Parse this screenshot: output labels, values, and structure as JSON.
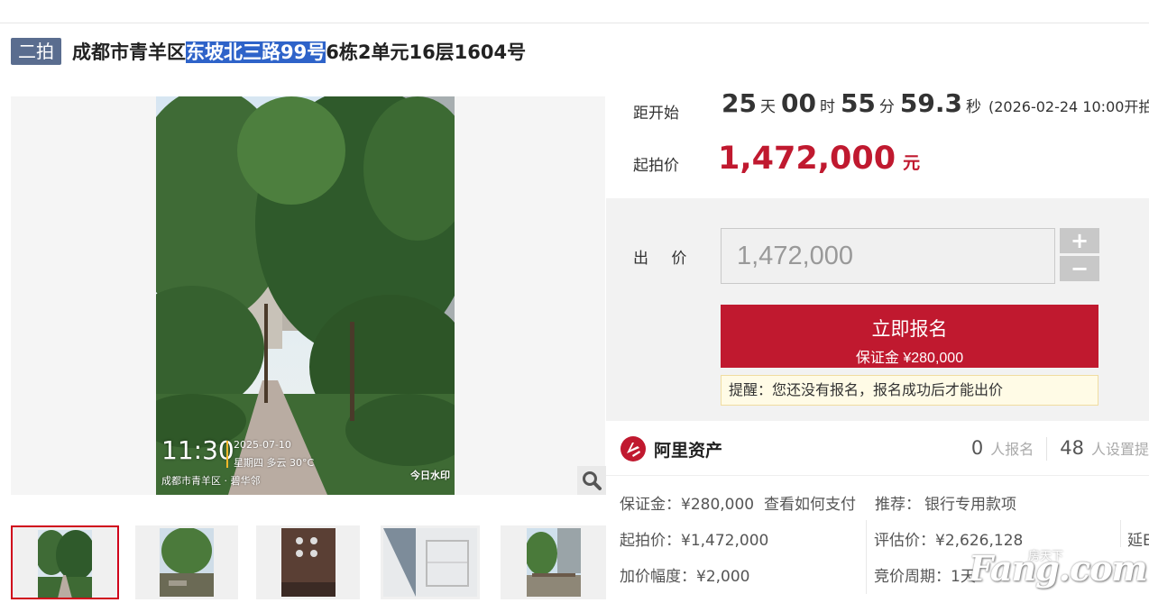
{
  "title": {
    "badge": "二拍",
    "prefix": "成都市青羊区",
    "highlight": "东坡北三路99号",
    "suffix": "6栋2单元16层1604号"
  },
  "photo_watermark": {
    "time": "11:30",
    "date": "2025-07-10",
    "week_weather": "星期四 多云 30°C",
    "location": "成都市青羊区 · 碧华邻",
    "brand": "今日水印"
  },
  "countdown": {
    "label": "距开始",
    "days": "25",
    "days_unit": "天",
    "hours": "00",
    "hours_unit": "时",
    "minutes": "55",
    "minutes_unit": "分",
    "seconds": "59.3",
    "seconds_unit": "秒",
    "open_text": "(2026-02-24 10:00开拍"
  },
  "start_price": {
    "label": "起拍价",
    "value": "1,472,000",
    "unit": "元"
  },
  "bid": {
    "label": "出 价",
    "input_value": "1,472,000",
    "plus": "+",
    "minus": "−",
    "signup_label": "立即报名",
    "deposit_label": "保证金 ¥280,000",
    "reminder": "提醒：您还没有报名，报名成功后才能出价"
  },
  "info": {
    "platform": "阿里资产",
    "signup_count": "0",
    "signup_text": "人报名",
    "remind_count": "48",
    "remind_text": "人设置提",
    "deposit_key": "保证金：¥280,000",
    "pay_link": "查看如何支付",
    "recommend_key": "推荐：",
    "recommend_link": "银行专用款项",
    "start_price_kv": "起拍价：¥1,472,000",
    "eval_price_kv": "评估价：¥2,626,128",
    "extend_kv": "延E",
    "increment_kv": "加价幅度：¥2,000",
    "cycle_kv": "竞价周期：1天"
  },
  "site_watermark": {
    "logo": "Fang.com",
    "small": "房天下"
  },
  "colors": {
    "accent_red": "#c0192f",
    "badge_blue": "#5a6d8f",
    "link_blue": "#3c7fd0",
    "highlight": "#2e63c9"
  }
}
